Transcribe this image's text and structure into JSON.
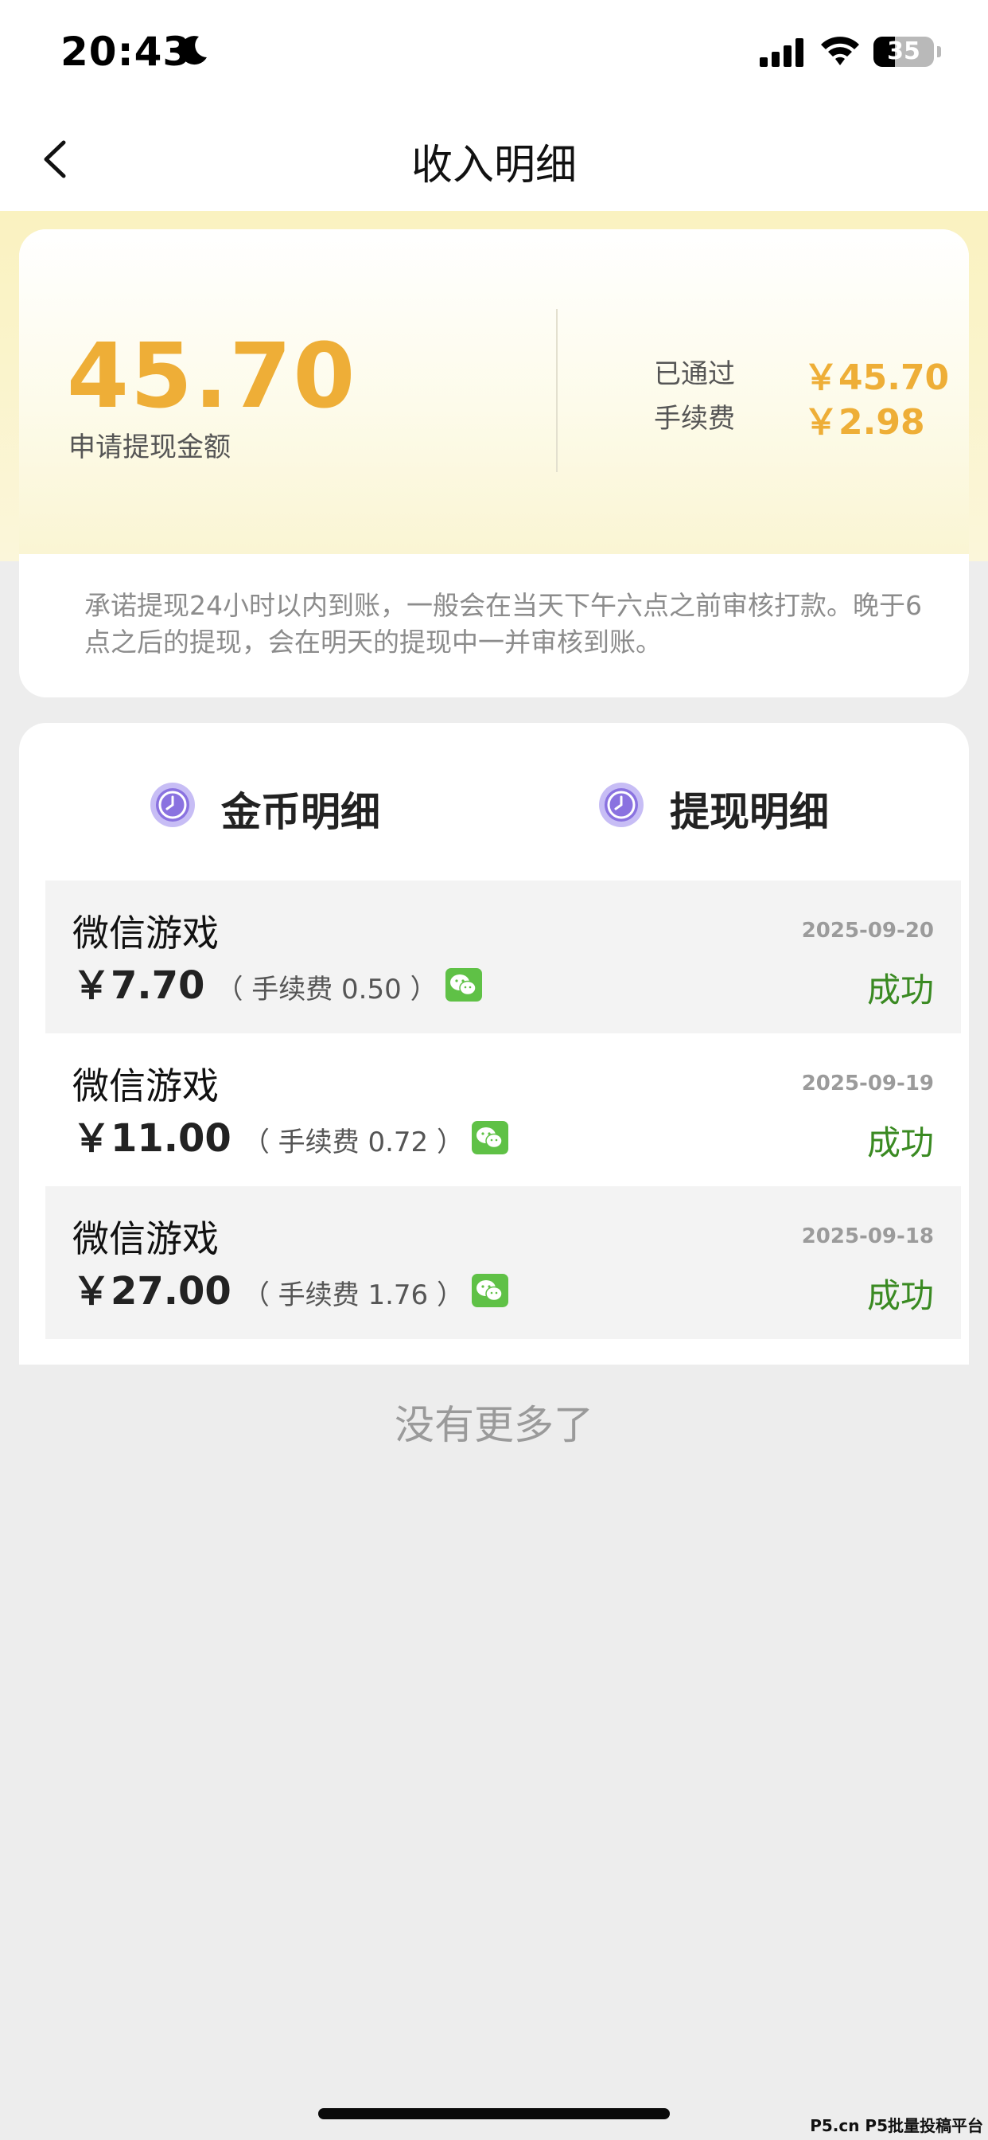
{
  "status_bar": {
    "time": "20:43",
    "battery": "35"
  },
  "nav": {
    "title": "收入明细"
  },
  "summary": {
    "amount": "45.70",
    "amount_label": "申请提现金额",
    "approved_label": "已通过",
    "approved_value": "￥45.70",
    "fee_label": "手续费",
    "fee_value": "￥2.98",
    "notice": "承诺提现24小时以内到账，一般会在当天下午六点之前审核打款。晚于6点之后的提现，会在明天的提现中一并审核到账。"
  },
  "tabs": [
    {
      "label": "金币明细",
      "active": false
    },
    {
      "label": "提现明细",
      "active": true
    }
  ],
  "records": [
    {
      "title": "微信游戏",
      "amount": "￥7.70",
      "fee": "（ 手续费 0.50 ）",
      "date": "2025-09-20",
      "status": "成功"
    },
    {
      "title": "微信游戏",
      "amount": "￥11.00",
      "fee": "（ 手续费 0.72 ）",
      "date": "2025-09-19",
      "status": "成功"
    },
    {
      "title": "微信游戏",
      "amount": "￥27.00",
      "fee": "（ 手续费 1.76 ）",
      "date": "2025-09-18",
      "status": "成功"
    }
  ],
  "footer": {
    "no_more": "没有更多了"
  },
  "watermark": "P5.cn P5批量投稿平台",
  "colors": {
    "accent_gold": "#eeae37",
    "success_green": "#3a8a22",
    "tab_underline": "#e8322a",
    "clock_purple": "#8a72e0",
    "wechat_green": "#5fc146"
  }
}
